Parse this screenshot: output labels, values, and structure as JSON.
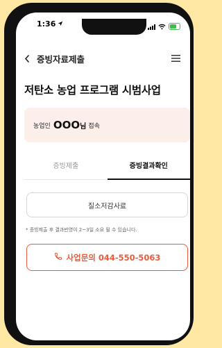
{
  "status_bar": {
    "time": "1:36"
  },
  "header": {
    "title": "증빙자료제출"
  },
  "page": {
    "title": "저탄소 농업 프로그램 시범사업"
  },
  "user": {
    "prefix": "농업인",
    "name": "OOO",
    "suffix": "님",
    "connected": "접속"
  },
  "tabs": [
    {
      "label": "증빙제출",
      "active": false
    },
    {
      "label": "증빙결과확인",
      "active": true
    }
  ],
  "pdf_button": {
    "label": "질소저감사료"
  },
  "notice": "* 증빙제출 후 결과반영이 2~3일 소요 될 수 있습니다.",
  "contact": {
    "label": "사업문의 044-550-5063"
  },
  "colors": {
    "background": "#ffe8a3",
    "accent": "#ea5a3a",
    "card": "#fcefe9",
    "battery": "#3bbf4a"
  }
}
